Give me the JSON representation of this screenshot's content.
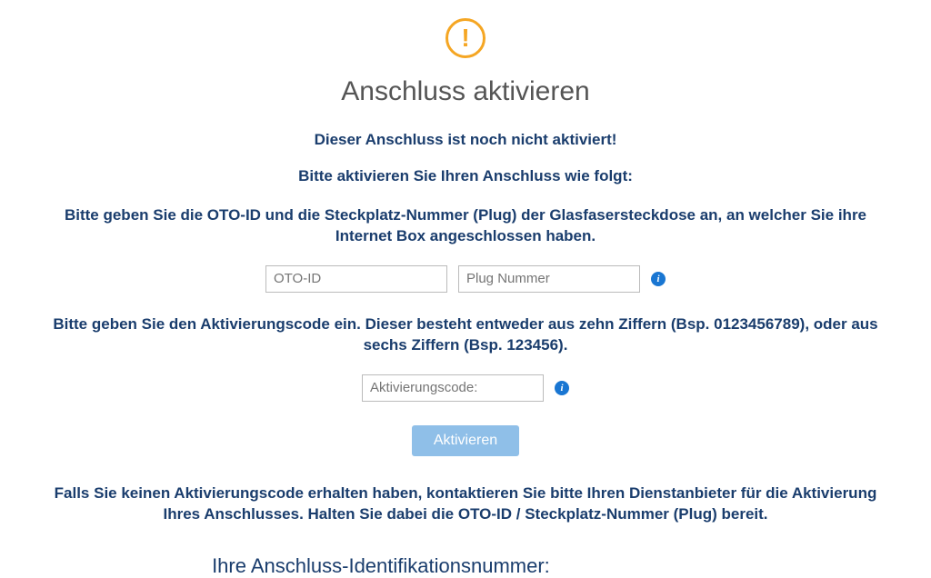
{
  "title": "Anschluss aktivieren",
  "notice": "Dieser Anschluss ist noch nicht aktiviert!",
  "instruction": "Bitte aktivieren Sie Ihren Anschluss wie folgt:",
  "oto_paragraph": "Bitte geben Sie die OTO-ID und die Steckplatz-Nummer (Plug) der Glasfasersteckdose an, an welcher Sie ihre Internet Box angeschlossen haben.",
  "inputs": {
    "oto_id_placeholder": "OTO-ID",
    "plug_placeholder": "Plug Nummer",
    "activation_code_placeholder": "Aktivierungscode:"
  },
  "activation_paragraph": "Bitte geben Sie den Aktivierungscode ein. Dieser besteht entweder aus zehn Ziffern (Bsp. 0123456789), oder aus sechs Ziffern (Bsp. 123456).",
  "activate_button": "Aktivieren",
  "no_code_paragraph": "Falls Sie keinen Aktivierungscode erhalten haben, kontaktieren Sie bitte Ihren Dienstanbieter für die Aktivierung Ihres Anschlusses. Halten Sie dabei die OTO-ID / Steckplatz-Nummer (Plug) bereit.",
  "id_label": "Ihre Anschluss-Identifikationsnummer:",
  "id_value": ""
}
